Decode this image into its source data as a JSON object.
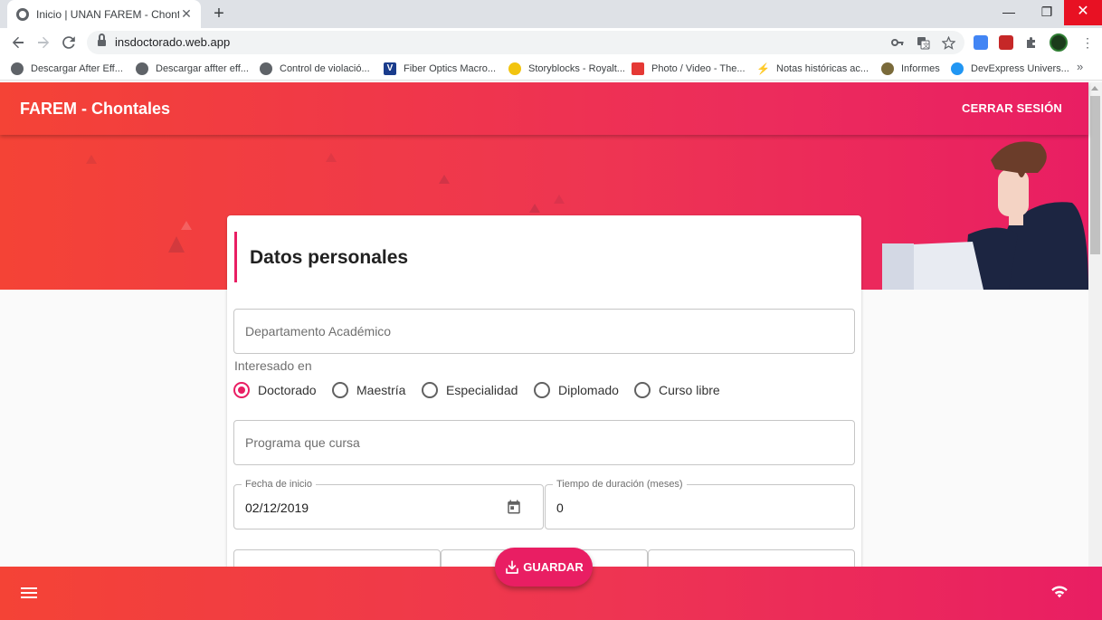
{
  "browser": {
    "tab_title": "Inicio | UNAN FAREM - Chontales",
    "tab_close": "✕",
    "new_tab": "+",
    "url": "insdoctorado.web.app",
    "window_controls": {
      "minimize": "—",
      "maximize": "❐",
      "close": "✕"
    },
    "bookmarks": [
      {
        "label": "Descargar After Eff...",
        "icon": "globe-icon",
        "color": "#5f6368"
      },
      {
        "label": "Descargar affter eff...",
        "icon": "globe-icon",
        "color": "#5f6368"
      },
      {
        "label": "Control de violació...",
        "icon": "globe-icon",
        "color": "#5f6368"
      },
      {
        "label": "Fiber Optics Macro...",
        "icon": "v-logo-icon",
        "color": "#1a3c8c"
      },
      {
        "label": "Storyblocks - Royalt...",
        "icon": "storyblocks-icon",
        "color": "#f2c40f"
      },
      {
        "label": "Photo / Video - The...",
        "icon": "photo-video-icon",
        "color": "#e53935"
      },
      {
        "label": "Notas históricas ac...",
        "icon": "bolt-icon",
        "color": "#1e3a5f"
      },
      {
        "label": "Informes",
        "icon": "informes-icon",
        "color": "#7a6a3a"
      },
      {
        "label": "DevExpress Univers...",
        "icon": "devexpress-icon",
        "color": "#2196f3"
      }
    ],
    "bookmarks_more": "»"
  },
  "app": {
    "brand": "FAREM - Chontales",
    "logout": "CERRAR SESIÓN",
    "accent_color": "#e91e63",
    "gradient_start": "#f44336"
  },
  "form": {
    "heading": "Datos personales",
    "department_placeholder": "Departamento Académico",
    "interest_label": "Interesado en",
    "interest_options": [
      "Doctorado",
      "Maestría",
      "Especialidad",
      "Diplomado",
      "Curso libre"
    ],
    "interest_selected": "Doctorado",
    "program_placeholder": "Programa que cursa",
    "start_date_label": "Fecha de inicio",
    "start_date_value": "02/12/2019",
    "duration_label": "Tiempo de duración (meses)",
    "duration_value": "0"
  },
  "actions": {
    "save": "GUARDAR"
  }
}
